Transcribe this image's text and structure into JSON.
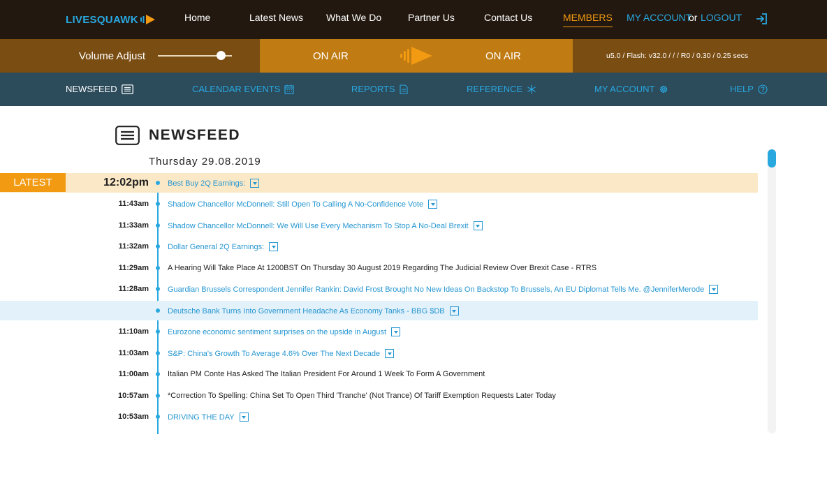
{
  "brand": {
    "part1": "LIVESQUAWK",
    "part2": ""
  },
  "topnav": {
    "home": "Home",
    "latest_news": "Latest News",
    "what_we_do": "What We Do",
    "partner_us": "Partner Us",
    "contact_us": "Contact Us",
    "members": "MEMBERS",
    "my_account": "MY ACCOUNT",
    "or": "or",
    "logout": "LOGOUT"
  },
  "audio": {
    "volume_label": "Volume Adjust",
    "volume_level": 0.85,
    "on_air_left": "ON AIR",
    "on_air_right": "ON AIR",
    "versions": "u5.0 / Flash: v32.0 /      /    / R0 / 0.30 / 0.25 secs"
  },
  "secnav": {
    "newsfeed": "NEWSFEED",
    "calendar": "CALENDAR EVENTS",
    "reports": "REPORTS",
    "reference": "REFERENCE",
    "my_account": "MY ACCOUNT",
    "help": "HELP"
  },
  "feed": {
    "title": "NEWSFEED",
    "date": "Thursday 29.08.2019",
    "latest_badge": "LATEST",
    "items": [
      {
        "time": "12:02pm",
        "text": "Best Buy 2Q Earnings:",
        "link": true,
        "dropdown": true
      },
      {
        "time": "11:43am",
        "text": "Shadow Chancellor McDonnell: Still Open To Calling A No-Confidence Vote",
        "link": true,
        "dropdown": true
      },
      {
        "time": "11:33am",
        "text": "Shadow Chancellor McDonnell: We Will Use Every Mechanism To Stop A No-Deal Brexit",
        "link": true,
        "dropdown": true
      },
      {
        "time": "11:32am",
        "text": "Dollar General 2Q Earnings:",
        "link": true,
        "dropdown": true
      },
      {
        "time": "11:29am",
        "text": "A Hearing Will Take Place At 1200BST On Thursday 30 August 2019 Regarding The Judicial Review Over Brexit Case - RTRS",
        "link": false,
        "dropdown": false
      },
      {
        "time": "11:28am",
        "text": "Guardian Brussels Correspondent Jennifer Rankin: David Frost Brought No New Ideas On Backstop To Brussels, An EU Diplomat Tells Me. @JenniferMerode",
        "link": true,
        "dropdown": true
      },
      {
        "time": "",
        "text": "Deutsche Bank Turns Into Government Headache As Economy Tanks - BBG $DB",
        "link": true,
        "dropdown": true
      },
      {
        "time": "11:10am",
        "text": "Eurozone economic sentiment surprises on the upside in August",
        "link": true,
        "dropdown": true
      },
      {
        "time": "11:03am",
        "text": "S&P: China's Growth To Average 4.6% Over The Next Decade",
        "link": true,
        "dropdown": true
      },
      {
        "time": "11:00am",
        "text": "Italian PM Conte Has Asked The Italian President For Around 1 Week To Form A Government",
        "link": false,
        "dropdown": false
      },
      {
        "time": "10:57am",
        "text": "*Correction To Spelling: China Set To Open Third 'Tranche' (Not Trance) Of Tariff Exemption Requests Later Today",
        "link": false,
        "dropdown": false
      },
      {
        "time": "10:53am",
        "text": "DRIVING THE DAY",
        "link": true,
        "dropdown": true
      }
    ]
  },
  "colors": {
    "accent_blue": "#29a8e0",
    "accent_orange": "#f29a12",
    "topbar": "#22180f",
    "audiobar": "#7a4d12",
    "onair": "#c07b13",
    "secnav": "#2c4b5b"
  },
  "icons": {
    "logout": "logout-arrow-icon",
    "newsfeed": "list-icon",
    "calendar": "calendar-icon",
    "reports": "document-icon",
    "reference": "asterisk-icon",
    "account": "gear-icon",
    "help": "question-icon",
    "onair": "speaker-play-icon",
    "dropdown": "chevron-down-icon"
  }
}
